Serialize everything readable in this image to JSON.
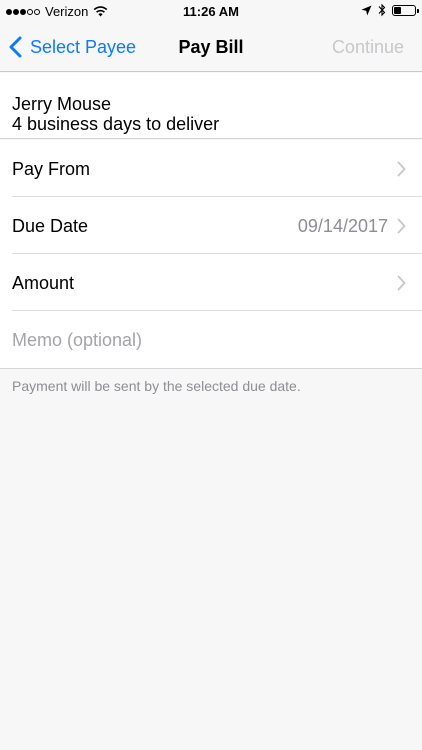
{
  "status_bar": {
    "carrier": "Verizon",
    "time": "11:26 AM",
    "signal_bars_filled": 3,
    "signal_bars_total": 5,
    "battery_level": 0.35,
    "icons": [
      "wifi-icon",
      "location-arrow-icon",
      "bluetooth-icon",
      "battery-icon"
    ]
  },
  "nav": {
    "back_label": "Select Payee",
    "title": "Pay Bill",
    "continue_label": "Continue",
    "accent_color": "#0a7aff",
    "disabled_color": "#c7c7cc"
  },
  "payee": {
    "name": "Jerry Mouse",
    "delivery": "4 business days to deliver"
  },
  "rows": [
    {
      "label": "Pay From",
      "value": ""
    },
    {
      "label": "Due Date",
      "value": "09/14/2017"
    },
    {
      "label": "Amount",
      "value": ""
    }
  ],
  "memo": {
    "placeholder": "Memo (optional)"
  },
  "footer_note": "Payment will be sent by the selected due date."
}
